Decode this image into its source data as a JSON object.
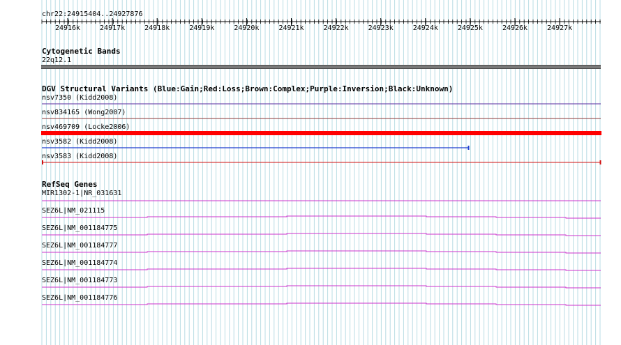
{
  "location": {
    "label": "chr22:24915404..24927876"
  },
  "ruler": {
    "ticks": [
      "24916k",
      "24917k",
      "24918k",
      "24919k",
      "24920k",
      "24921k",
      "24922k",
      "24923k",
      "24924k",
      "24925k",
      "24926k",
      "24927k"
    ]
  },
  "tracks": {
    "cytoband": {
      "title": "Cytogenetic Bands",
      "band": "22q12.1",
      "color": "#808080"
    },
    "dgv": {
      "title": "DGV Structural Variants (Blue:Gain;Red:Loss;Brown:Complex;Purple:Inversion;Black:Unknown)",
      "features": [
        {
          "label": "nsv7350 (Kidd2008)",
          "color": "#5a2ca0",
          "type": "inversion"
        },
        {
          "label": "nsv834165 (Wong2007)",
          "color": "#8b3a3a",
          "type": "complex"
        },
        {
          "label": "nsv469709 (Locke2006)",
          "color": "#ff0000",
          "type": "loss"
        },
        {
          "label": "nsv3582 (Kidd2008)",
          "color": "#1f3fcf",
          "type": "gain"
        },
        {
          "label": "nsv3583 (Kidd2008)",
          "color": "#d01010",
          "type": "loss"
        }
      ]
    },
    "refseq": {
      "title": "RefSeq Genes",
      "color": "#cc33cc",
      "features": [
        {
          "label": "MIR1302-1|NR_031631"
        },
        {
          "label": "SEZ6L|NM_021115"
        },
        {
          "label": "SEZ6L|NM_001184775"
        },
        {
          "label": "SEZ6L|NM_001184777"
        },
        {
          "label": "SEZ6L|NM_001184774"
        },
        {
          "label": "SEZ6L|NM_001184773"
        },
        {
          "label": "SEZ6L|NM_001184776"
        }
      ]
    }
  },
  "grid": {
    "color": "#b9dce4"
  }
}
